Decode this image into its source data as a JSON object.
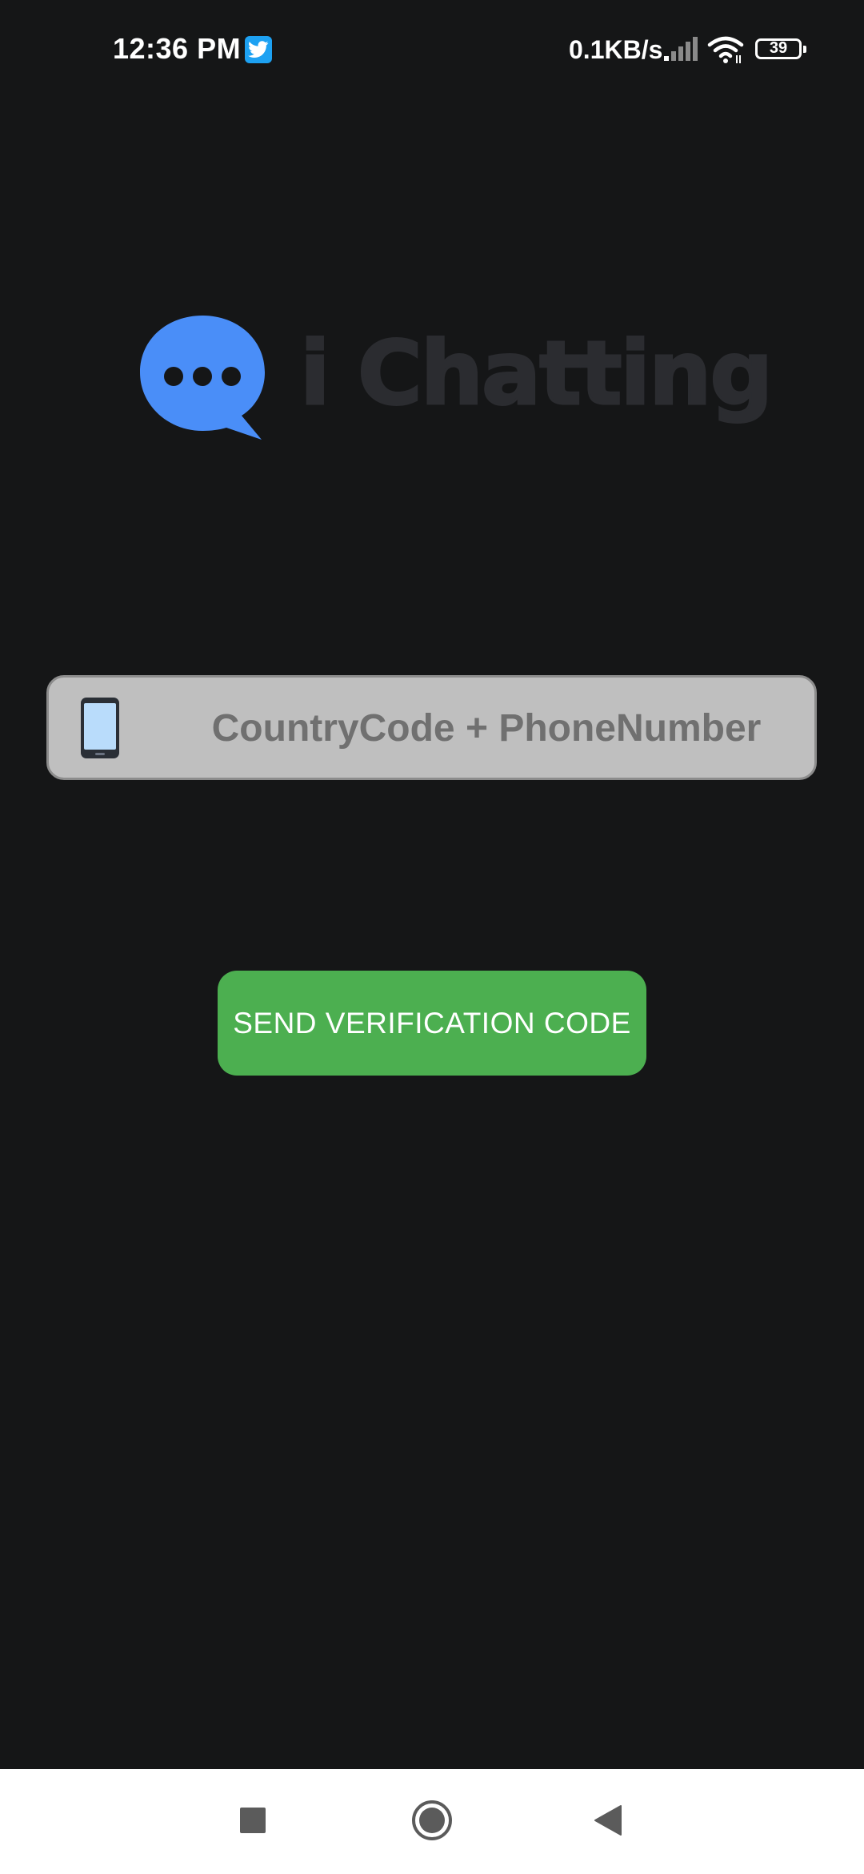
{
  "status_bar": {
    "time": "12:36 PM",
    "net_speed": "0.1KB/s",
    "battery_percent": "39",
    "battery_level": 0.39,
    "notification_icon": "twitter-icon",
    "signal_icon": "cell-signal-icon",
    "wifi_icon": "wifi-icon"
  },
  "logo": {
    "icon": "chat-bubble-icon",
    "text": "i Chatting",
    "icon_color": "#4a8ef8",
    "text_color": "#2b2c30"
  },
  "phone_field": {
    "icon": "smartphone-icon",
    "placeholder": "CountryCode + PhoneNumber",
    "value": ""
  },
  "send_button": {
    "label": "SEND VERIFICATION CODE",
    "color": "#4caf50"
  },
  "nav_bar": {
    "recents_icon": "square-icon",
    "home_icon": "circle-icon",
    "back_icon": "triangle-back-icon"
  },
  "colors": {
    "background": "#151617",
    "input_background": "#bfbfbf",
    "nav_background": "#ffffff"
  }
}
